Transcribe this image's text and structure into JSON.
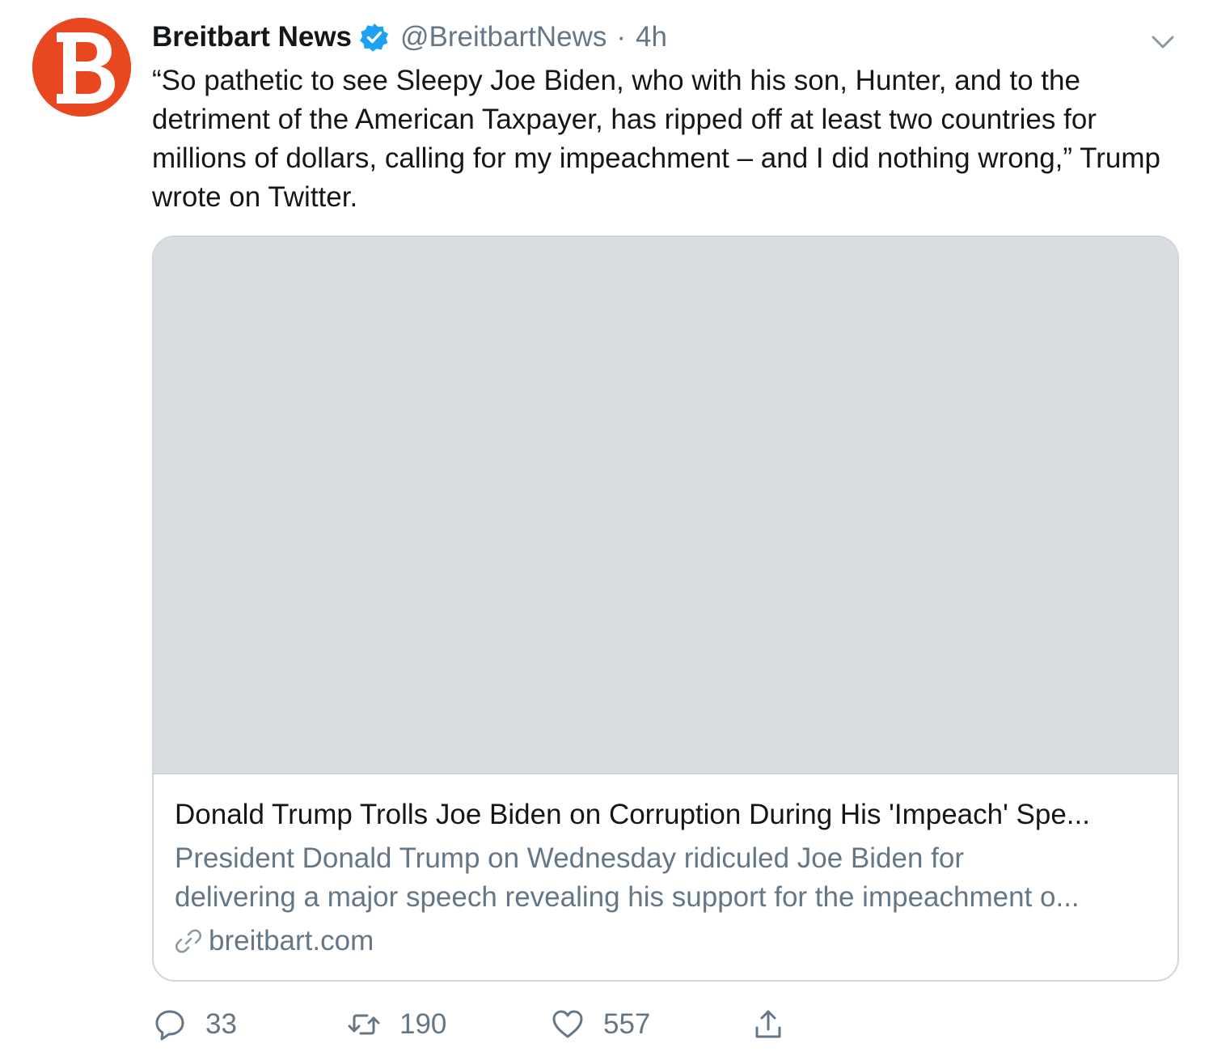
{
  "tweet": {
    "display_name": "Breitbart News",
    "handle": "@BreitbartNews",
    "separator": "·",
    "time": "4h",
    "avatar_letter": "B",
    "text": "“So pathetic to see Sleepy Joe Biden, who with his son, Hunter, and to the detriment of the American Taxpayer, has ripped off at least two countries for millions of dollars, calling for my impeachment – and I did nothing wrong,” Trump wrote on Twitter."
  },
  "card": {
    "title": "Donald Trump Trolls Joe Biden on Corruption During His 'Impeach' Spe...",
    "description_line1": "President Donald Trump on Wednesday ridiculed Joe Biden for",
    "description_line2": "delivering a major speech revealing his support for the impeachment o...",
    "domain": "breitbart.com"
  },
  "actions": {
    "replies": "33",
    "retweets": "190",
    "likes": "557"
  },
  "colors": {
    "brand": "#e9471f",
    "verified": "#1da1f2",
    "muted_text": "#657786",
    "border": "#ccd6dd"
  },
  "icons": {
    "reply": "speech-bubble",
    "retweet": "retweet-arrows",
    "like": "heart-outline",
    "share": "share-arrow-up",
    "verified": "verified-badge",
    "menu": "chevron-down",
    "link": "link"
  }
}
